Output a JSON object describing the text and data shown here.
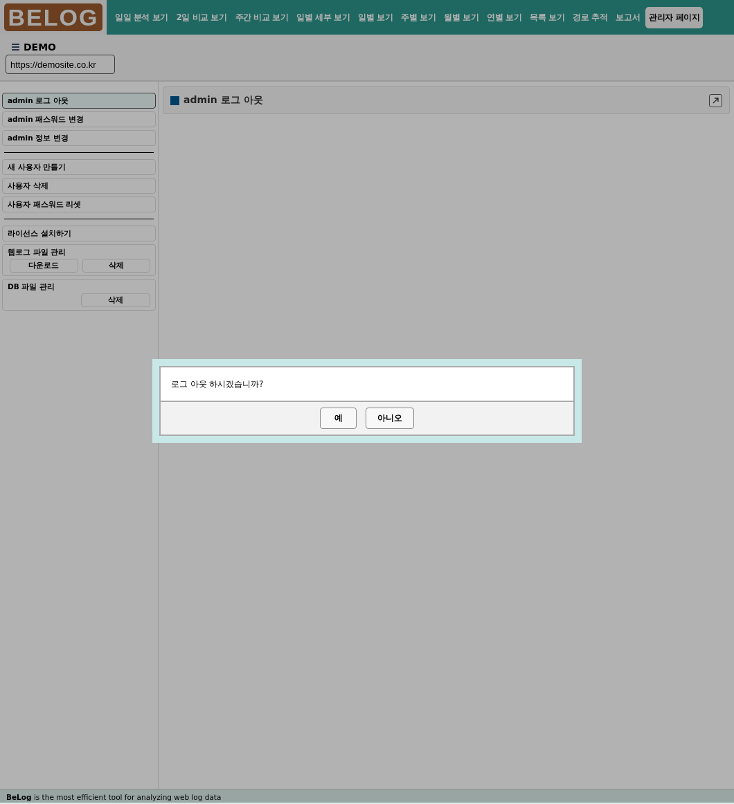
{
  "logo": "BELOG",
  "nav": [
    {
      "label": "일일 분석 보기",
      "selected": false
    },
    {
      "label": "2일 비교 보기",
      "selected": false
    },
    {
      "label": "주간 비교 보기",
      "selected": false
    },
    {
      "label": "일별 세부 보기",
      "selected": false
    },
    {
      "label": "일별 보기",
      "selected": false
    },
    {
      "label": "주별 보기",
      "selected": false
    },
    {
      "label": "월별 보기",
      "selected": false
    },
    {
      "label": "연별 보기",
      "selected": false
    },
    {
      "label": "목록 보기",
      "selected": false
    },
    {
      "label": "경로 추적",
      "selected": false
    },
    {
      "label": "보고서",
      "selected": false
    },
    {
      "label": "관리자 페이지",
      "selected": true
    }
  ],
  "site": {
    "name": "DEMO",
    "url": "https://demosite.co.kr"
  },
  "sidebar": {
    "items": [
      {
        "kind": "item",
        "label": "admin 로그 아웃",
        "selected": true
      },
      {
        "kind": "item",
        "label": "admin 패스워드 변경",
        "selected": false
      },
      {
        "kind": "item",
        "label": "admin 정보 변경",
        "selected": false
      },
      {
        "kind": "divider"
      },
      {
        "kind": "item",
        "label": "새 사용자 만들기",
        "selected": false
      },
      {
        "kind": "item",
        "label": "사용자 삭제",
        "selected": false
      },
      {
        "kind": "item",
        "label": "사용자 패스워드 리셋",
        "selected": false
      },
      {
        "kind": "divider"
      },
      {
        "kind": "item",
        "label": "라이선스 설치하기",
        "selected": false
      },
      {
        "kind": "group",
        "label": "웹로그 파일 관리",
        "buttons": [
          "다운로드",
          "삭제"
        ]
      },
      {
        "kind": "group",
        "label": "DB 파일 관리",
        "buttons": [
          "삭제"
        ]
      }
    ]
  },
  "panel": {
    "title": "admin 로그 아웃"
  },
  "dialog": {
    "message": "로그 아웃 하시겠습니까?",
    "buttons": [
      "예",
      "아니오"
    ]
  },
  "footer": "**BeLog** is the most efficient tool for analyzing web log data"
}
